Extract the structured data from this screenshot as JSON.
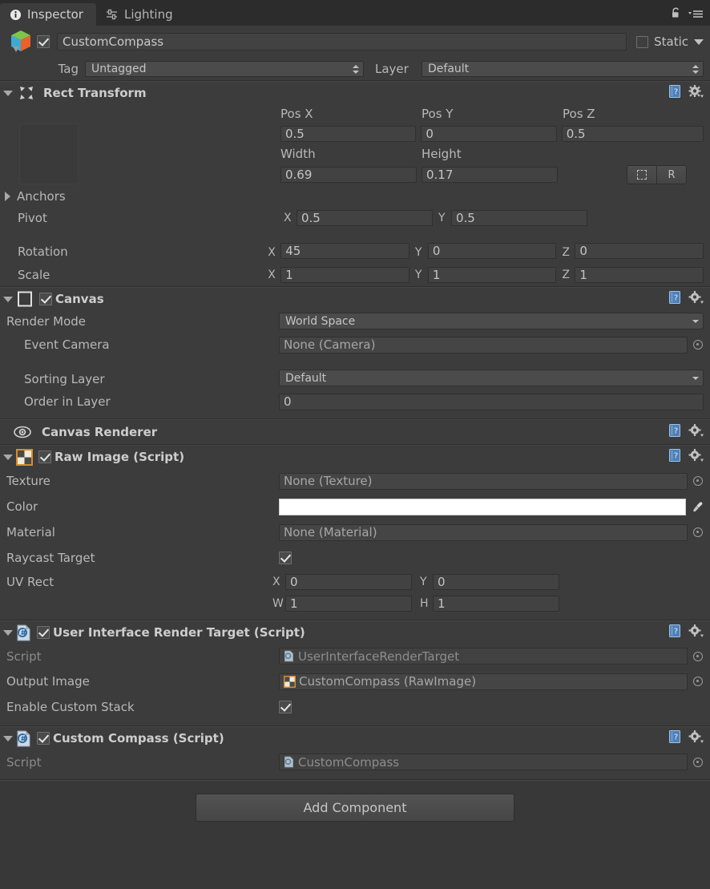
{
  "window": {
    "tabs": [
      {
        "label": "Inspector",
        "icon": "info-icon",
        "active": true
      },
      {
        "label": "Lighting",
        "icon": "lighting-sliders-icon",
        "active": false
      }
    ],
    "lock_icon": "lock-open-icon",
    "menu_icon": "hamburger-menu-icon"
  },
  "gameobject": {
    "icon": "gameobject-cube-icon",
    "enabled": true,
    "name": "CustomCompass",
    "static_label": "Static",
    "static_checked": false,
    "tag_label": "Tag",
    "tag_value": "Untagged",
    "layer_label": "Layer",
    "layer_value": "Default"
  },
  "components": [
    {
      "name": "rect-transform",
      "title": "Rect Transform",
      "icon": "rect-transform-icon",
      "expanded": true,
      "has_enable_checkbox": false,
      "help_icon": "help-book-icon",
      "settings_icon": "gear-icon",
      "pos_headers": [
        "Pos X",
        "Pos Y",
        "Pos Z"
      ],
      "pos_values": [
        "0.5",
        "0",
        "0.5"
      ],
      "size_headers": [
        "Width",
        "Height"
      ],
      "size_values": [
        "0.69",
        "0.17"
      ],
      "blueprint_buttons": [
        "raw-edit-icon",
        "R"
      ],
      "anchors_label": "Anchors",
      "pivot_label": "Pivot",
      "pivot_axes": [
        "X",
        "Y"
      ],
      "pivot_values": [
        "0.5",
        "0.5"
      ],
      "rotation_label": "Rotation",
      "rotation_axes": [
        "X",
        "Y",
        "Z"
      ],
      "rotation_values": [
        "45",
        "0",
        "0"
      ],
      "scale_label": "Scale",
      "scale_axes": [
        "X",
        "Y",
        "Z"
      ],
      "scale_values": [
        "1",
        "1",
        "1"
      ]
    },
    {
      "name": "canvas",
      "title": "Canvas",
      "icon": "canvas-icon",
      "expanded": true,
      "enabled": true,
      "rows": [
        {
          "label": "Render Mode",
          "type": "popup",
          "value": "World Space",
          "indent": 0
        },
        {
          "label": "Event Camera",
          "type": "object",
          "value": "None (Camera)",
          "indent": 1
        },
        {
          "label": "Sorting Layer",
          "type": "popup",
          "value": "Default",
          "indent": 1
        },
        {
          "label": "Order in Layer",
          "type": "text",
          "value": "0",
          "indent": 1
        }
      ]
    },
    {
      "name": "canvas-renderer",
      "title": "Canvas Renderer",
      "icon": "eye-icon",
      "expanded": false,
      "has_enable_checkbox": false,
      "rows": []
    },
    {
      "name": "raw-image",
      "title": "Raw Image (Script)",
      "icon": "raw-image-checker-icon",
      "expanded": true,
      "enabled": true,
      "rows": [
        {
          "label": "Texture",
          "type": "object",
          "value": "None (Texture)"
        },
        {
          "label": "Color",
          "type": "color",
          "value": "#ffffff"
        },
        {
          "label": "Material",
          "type": "object",
          "value": "None (Material)"
        },
        {
          "label": "Raycast Target",
          "type": "checkbox",
          "value": true
        }
      ],
      "uv_rect_label": "UV Rect",
      "uv_axes": [
        "X",
        "Y",
        "W",
        "H"
      ],
      "uv_values": [
        "0",
        "0",
        "1",
        "1"
      ]
    },
    {
      "name": "user-interface-render-target",
      "title": "User Interface Render Target (Script)",
      "icon": "csharp-script-icon",
      "expanded": true,
      "enabled": true,
      "rows": [
        {
          "label": "Script",
          "type": "script",
          "value": "UserInterfaceRenderTarget",
          "dim": true
        },
        {
          "label": "Output Image",
          "type": "object-icon",
          "value": "CustomCompass (RawImage)",
          "value_icon": "raw-image-checker-icon"
        },
        {
          "label": "Enable Custom Stack",
          "type": "checkbox",
          "value": true
        }
      ]
    },
    {
      "name": "custom-compass",
      "title": "Custom Compass (Script)",
      "icon": "csharp-script-icon",
      "expanded": true,
      "enabled": true,
      "rows": [
        {
          "label": "Script",
          "type": "script",
          "value": "CustomCompass",
          "dim": true
        }
      ]
    }
  ],
  "footer": {
    "add_component_label": "Add Component"
  },
  "colors": {
    "window_bg": "#383838",
    "panel_bg": "#3c3c3c",
    "tabbar_bg": "#2c2c2c",
    "field_bg": "#424242",
    "text": "#b8b8b8",
    "accent_orange": "#d88b26",
    "script_blue": "#5a9fd4"
  }
}
